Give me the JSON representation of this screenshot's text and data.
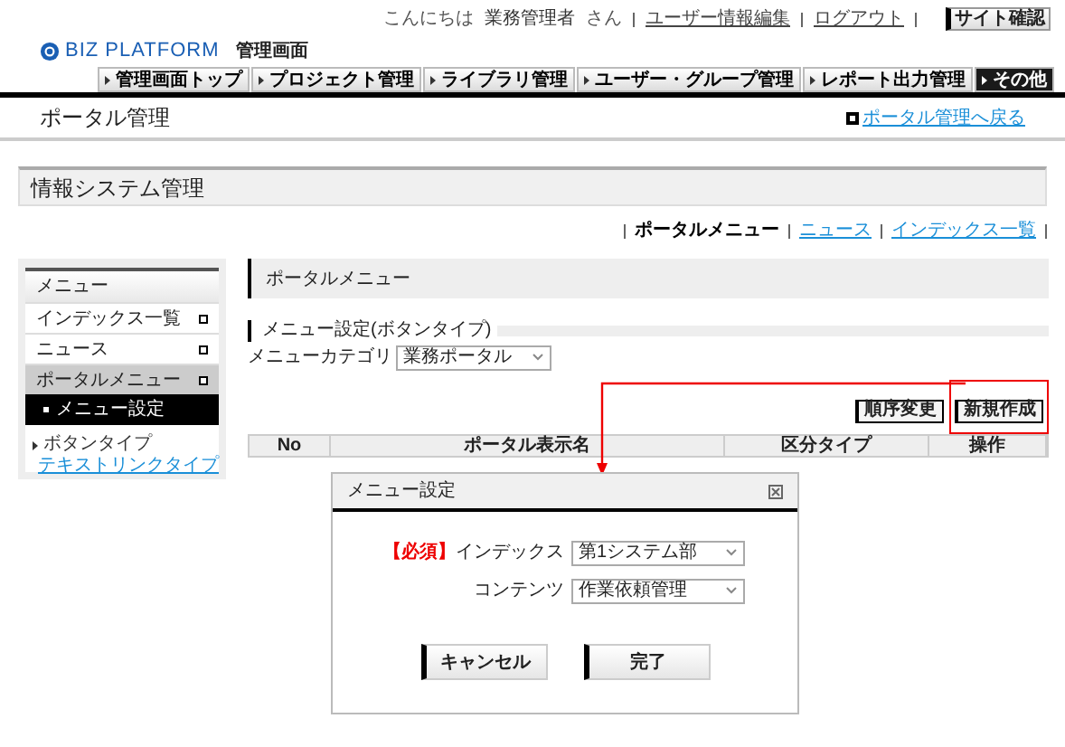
{
  "header": {
    "greeting": "こんにちは",
    "user": "業務管理者",
    "honorific": "さん",
    "links": [
      "ユーザー情報編集",
      "ログアウト"
    ],
    "site_button": "サイト確認",
    "logo": "BIZ PLATFORM",
    "logo_sub": "管理画面"
  },
  "nav_tabs": [
    {
      "label": "管理画面トップ",
      "selected": false
    },
    {
      "label": "プロジェクト管理",
      "selected": false
    },
    {
      "label": "ライブラリ管理",
      "selected": false
    },
    {
      "label": "ユーザー・グループ管理",
      "selected": false
    },
    {
      "label": "レポート出力管理",
      "selected": false
    },
    {
      "label": "その他",
      "selected": true
    }
  ],
  "page_title": "ポータル管理",
  "back_link": "ポータル管理へ戻る",
  "section_title": "情報システム管理",
  "sub_nav": [
    {
      "label": "ポータルメニュー",
      "selected": true
    },
    {
      "label": "ニュース",
      "selected": false
    },
    {
      "label": "インデックス一覧",
      "selected": false
    }
  ],
  "sidebar": {
    "title": "メニュー",
    "items": [
      {
        "label": "インデックス一覧",
        "selected": false
      },
      {
        "label": "ニュース",
        "selected": false
      },
      {
        "label": "ポータルメニュー",
        "selected": true,
        "children": [
          {
            "label": "メニュー設定",
            "selected": true
          }
        ]
      }
    ],
    "links": [
      {
        "label": "ボタンタイプ",
        "selected": true
      },
      {
        "label": "テキストリンクタイプ",
        "selected": false
      }
    ]
  },
  "main": {
    "heading": "ポータルメニュー",
    "subheading": "メニュー設定(ボタンタイプ)",
    "category_label": "メニューカテゴリ",
    "category_value": "業務ポータル",
    "buttons": [
      "順序変更",
      "新規作成"
    ],
    "columns": [
      "No",
      "ポータル表示名",
      "区分タイプ",
      "操作"
    ]
  },
  "dialog": {
    "title": "メニュー設定",
    "fields": [
      {
        "required": "【必須】",
        "label": "インデックス",
        "value": "第1システム部"
      },
      {
        "label": "コンテンツ",
        "value": "作業依頼管理"
      }
    ],
    "buttons": [
      "キャンセル",
      "完了"
    ]
  }
}
